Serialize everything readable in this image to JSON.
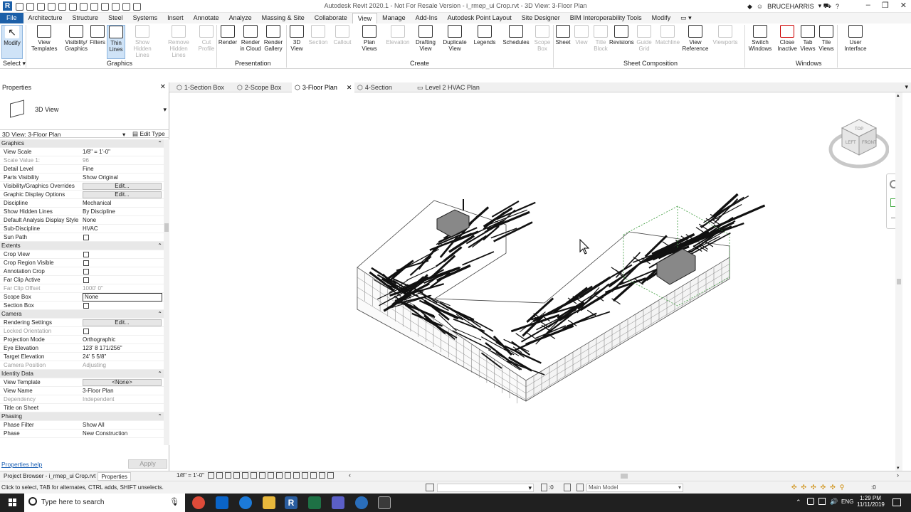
{
  "app": {
    "title": "Autodesk Revit 2020.1 - Not For Resale Version - i_rmep_ui Crop.rvt - 3D View: 3-Floor Plan",
    "user": "BRUCEHARRIS"
  },
  "menu": [
    "File",
    "Architecture",
    "Structure",
    "Steel",
    "Systems",
    "Insert",
    "Annotate",
    "Analyze",
    "Massing & Site",
    "Collaborate",
    "View",
    "Manage",
    "Add-Ins",
    "Autodesk Point Layout",
    "Site Designer",
    "BIM Interoperability Tools",
    "Modify"
  ],
  "ribbon": {
    "buttons": [
      {
        "label": "Modify",
        "icon": "cursor-icon"
      },
      {
        "label": "View Templates",
        "icon": "view-templates-icon"
      },
      {
        "label": "Visibility/ Graphics",
        "icon": "visibility-graphics-icon"
      },
      {
        "label": "Filters",
        "icon": "filters-icon"
      },
      {
        "label": "Thin Lines",
        "icon": "thin-lines-icon"
      },
      {
        "label": "Show Hidden Lines",
        "icon": "show-hidden-lines-icon"
      },
      {
        "label": "Remove Hidden Lines",
        "icon": "remove-hidden-lines-icon"
      },
      {
        "label": "Cut Profile",
        "icon": "cut-profile-icon"
      },
      {
        "label": "Render",
        "icon": "render-icon"
      },
      {
        "label": "Render in Cloud",
        "icon": "render-cloud-icon"
      },
      {
        "label": "Render Gallery",
        "icon": "render-gallery-icon"
      },
      {
        "label": "3D View",
        "icon": "3d-view-icon"
      },
      {
        "label": "Section",
        "icon": "section-icon"
      },
      {
        "label": "Callout",
        "icon": "callout-icon"
      },
      {
        "label": "Plan Views",
        "icon": "plan-views-icon"
      },
      {
        "label": "Elevation",
        "icon": "elevation-icon"
      },
      {
        "label": "Drafting View",
        "icon": "drafting-view-icon"
      },
      {
        "label": "Duplicate View",
        "icon": "duplicate-view-icon"
      },
      {
        "label": "Legends",
        "icon": "legends-icon"
      },
      {
        "label": "Schedules",
        "icon": "schedules-icon"
      },
      {
        "label": "Scope Box",
        "icon": "scope-box-icon"
      },
      {
        "label": "Sheet",
        "icon": "sheet-icon"
      },
      {
        "label": "View",
        "icon": "view-icon"
      },
      {
        "label": "Title Block",
        "icon": "title-block-icon"
      },
      {
        "label": "Revisions",
        "icon": "revisions-icon"
      },
      {
        "label": "Guide Grid",
        "icon": "guide-grid-icon"
      },
      {
        "label": "Matchline",
        "icon": "matchline-icon"
      },
      {
        "label": "View Reference",
        "icon": "view-reference-icon"
      },
      {
        "label": "Viewports",
        "icon": "viewports-icon"
      },
      {
        "label": "Switch Windows",
        "icon": "switch-windows-icon"
      },
      {
        "label": "Close Inactive",
        "icon": "close-inactive-icon"
      },
      {
        "label": "Tab Views",
        "icon": "tab-views-icon"
      },
      {
        "label": "Tile Views",
        "icon": "tile-views-icon"
      },
      {
        "label": "User Interface",
        "icon": "user-interface-icon"
      }
    ],
    "groups": [
      "Select",
      "Graphics",
      "Presentation",
      "Create",
      "Sheet Composition",
      "Windows"
    ]
  },
  "properties": {
    "title": "Properties",
    "type_name": "3D View",
    "selector": "3D View: 3-Floor Plan",
    "edit_type": "Edit Type",
    "help": "Properties help",
    "apply": "Apply",
    "rows": [
      {
        "k": "Graphics",
        "hdr": true
      },
      {
        "k": "View Scale",
        "v": "1/8\" = 1'-0\""
      },
      {
        "k": "Scale Value    1:",
        "v": "96",
        "gray": true
      },
      {
        "k": "Detail Level",
        "v": "Fine"
      },
      {
        "k": "Parts Visibility",
        "v": "Show Original"
      },
      {
        "k": "Visibility/Graphics Overrides",
        "btn": "Edit..."
      },
      {
        "k": "Graphic Display Options",
        "btn": "Edit..."
      },
      {
        "k": "Discipline",
        "v": "Mechanical"
      },
      {
        "k": "Show Hidden Lines",
        "v": "By Discipline"
      },
      {
        "k": "Default Analysis Display Style",
        "v": "None"
      },
      {
        "k": "Sub-Discipline",
        "v": "HVAC"
      },
      {
        "k": "Sun Path",
        "cb": true
      },
      {
        "k": "Extents",
        "hdr": true
      },
      {
        "k": "Crop View",
        "cb": true
      },
      {
        "k": "Crop Region Visible",
        "cb": true
      },
      {
        "k": "Annotation Crop",
        "cb": true
      },
      {
        "k": "Far Clip Active",
        "cb": true
      },
      {
        "k": "Far Clip Offset",
        "v": "1000'  0\"",
        "gray": true
      },
      {
        "k": "Scope Box",
        "box": "None"
      },
      {
        "k": "Section Box",
        "cb": true
      },
      {
        "k": "Camera",
        "hdr": true
      },
      {
        "k": "Rendering Settings",
        "btn": "Edit..."
      },
      {
        "k": "Locked Orientation",
        "cb": true,
        "gray": true
      },
      {
        "k": "Projection Mode",
        "v": "Orthographic"
      },
      {
        "k": "Eye Elevation",
        "v": "123'  8 171/256\""
      },
      {
        "k": "Target Elevation",
        "v": "24'  5 5/8\""
      },
      {
        "k": "Camera Position",
        "v": "Adjusting",
        "gray": true
      },
      {
        "k": "Identity Data",
        "hdr": true
      },
      {
        "k": "View Template",
        "btn": "<None>"
      },
      {
        "k": "View Name",
        "v": "3-Floor Plan"
      },
      {
        "k": "Dependency",
        "v": "Independent",
        "gray": true
      },
      {
        "k": "Title on Sheet",
        "v": ""
      },
      {
        "k": "Phasing",
        "hdr": true
      },
      {
        "k": "Phase Filter",
        "v": "Show All"
      },
      {
        "k": "Phase",
        "v": "New Construction"
      }
    ]
  },
  "tabs": [
    "1-Section Box",
    "2-Scope Box",
    "3-Floor Plan",
    "4-Section",
    "Level 2 HVAC Plan"
  ],
  "active_tab": "3-Floor Plan",
  "bottom": {
    "scale": "1/8\" = 1'-0\"",
    "browser_tab": "Project Browser - i_rmep_ui Crop.rvt",
    "props_tab": "Properties"
  },
  "status": {
    "hint": "Click to select, TAB for alternates, CTRL adds, SHIFT unselects.",
    "zero": ":0",
    "model": "Main Model"
  },
  "taskbar": {
    "search": "Type here to search",
    "time": "1:29 PM",
    "date": "11/11/2019",
    "lang": "ENG"
  },
  "viewcube": {
    "top": "TOP",
    "left": "LEFT",
    "front": "FRONT"
  },
  "colors": {
    "accent": "#1b5fa8",
    "taskbar": "#202020",
    "selection": "#cfe3f7"
  }
}
